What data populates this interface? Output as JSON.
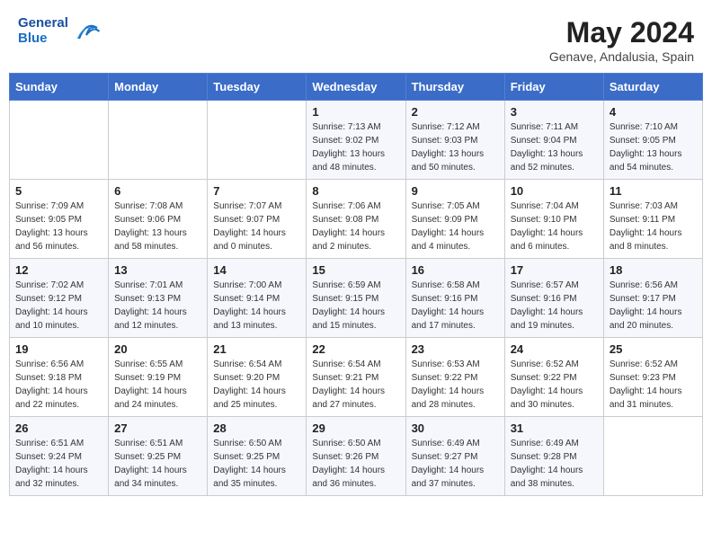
{
  "header": {
    "logo_general": "General",
    "logo_blue": "Blue",
    "month_year": "May 2024",
    "location": "Genave, Andalusia, Spain"
  },
  "weekdays": [
    "Sunday",
    "Monday",
    "Tuesday",
    "Wednesday",
    "Thursday",
    "Friday",
    "Saturday"
  ],
  "weeks": [
    [
      {
        "day": "",
        "sunrise": "",
        "sunset": "",
        "daylight": ""
      },
      {
        "day": "",
        "sunrise": "",
        "sunset": "",
        "daylight": ""
      },
      {
        "day": "",
        "sunrise": "",
        "sunset": "",
        "daylight": ""
      },
      {
        "day": "1",
        "sunrise": "Sunrise: 7:13 AM",
        "sunset": "Sunset: 9:02 PM",
        "daylight": "Daylight: 13 hours and 48 minutes."
      },
      {
        "day": "2",
        "sunrise": "Sunrise: 7:12 AM",
        "sunset": "Sunset: 9:03 PM",
        "daylight": "Daylight: 13 hours and 50 minutes."
      },
      {
        "day": "3",
        "sunrise": "Sunrise: 7:11 AM",
        "sunset": "Sunset: 9:04 PM",
        "daylight": "Daylight: 13 hours and 52 minutes."
      },
      {
        "day": "4",
        "sunrise": "Sunrise: 7:10 AM",
        "sunset": "Sunset: 9:05 PM",
        "daylight": "Daylight: 13 hours and 54 minutes."
      }
    ],
    [
      {
        "day": "5",
        "sunrise": "Sunrise: 7:09 AM",
        "sunset": "Sunset: 9:05 PM",
        "daylight": "Daylight: 13 hours and 56 minutes."
      },
      {
        "day": "6",
        "sunrise": "Sunrise: 7:08 AM",
        "sunset": "Sunset: 9:06 PM",
        "daylight": "Daylight: 13 hours and 58 minutes."
      },
      {
        "day": "7",
        "sunrise": "Sunrise: 7:07 AM",
        "sunset": "Sunset: 9:07 PM",
        "daylight": "Daylight: 14 hours and 0 minutes."
      },
      {
        "day": "8",
        "sunrise": "Sunrise: 7:06 AM",
        "sunset": "Sunset: 9:08 PM",
        "daylight": "Daylight: 14 hours and 2 minutes."
      },
      {
        "day": "9",
        "sunrise": "Sunrise: 7:05 AM",
        "sunset": "Sunset: 9:09 PM",
        "daylight": "Daylight: 14 hours and 4 minutes."
      },
      {
        "day": "10",
        "sunrise": "Sunrise: 7:04 AM",
        "sunset": "Sunset: 9:10 PM",
        "daylight": "Daylight: 14 hours and 6 minutes."
      },
      {
        "day": "11",
        "sunrise": "Sunrise: 7:03 AM",
        "sunset": "Sunset: 9:11 PM",
        "daylight": "Daylight: 14 hours and 8 minutes."
      }
    ],
    [
      {
        "day": "12",
        "sunrise": "Sunrise: 7:02 AM",
        "sunset": "Sunset: 9:12 PM",
        "daylight": "Daylight: 14 hours and 10 minutes."
      },
      {
        "day": "13",
        "sunrise": "Sunrise: 7:01 AM",
        "sunset": "Sunset: 9:13 PM",
        "daylight": "Daylight: 14 hours and 12 minutes."
      },
      {
        "day": "14",
        "sunrise": "Sunrise: 7:00 AM",
        "sunset": "Sunset: 9:14 PM",
        "daylight": "Daylight: 14 hours and 13 minutes."
      },
      {
        "day": "15",
        "sunrise": "Sunrise: 6:59 AM",
        "sunset": "Sunset: 9:15 PM",
        "daylight": "Daylight: 14 hours and 15 minutes."
      },
      {
        "day": "16",
        "sunrise": "Sunrise: 6:58 AM",
        "sunset": "Sunset: 9:16 PM",
        "daylight": "Daylight: 14 hours and 17 minutes."
      },
      {
        "day": "17",
        "sunrise": "Sunrise: 6:57 AM",
        "sunset": "Sunset: 9:16 PM",
        "daylight": "Daylight: 14 hours and 19 minutes."
      },
      {
        "day": "18",
        "sunrise": "Sunrise: 6:56 AM",
        "sunset": "Sunset: 9:17 PM",
        "daylight": "Daylight: 14 hours and 20 minutes."
      }
    ],
    [
      {
        "day": "19",
        "sunrise": "Sunrise: 6:56 AM",
        "sunset": "Sunset: 9:18 PM",
        "daylight": "Daylight: 14 hours and 22 minutes."
      },
      {
        "day": "20",
        "sunrise": "Sunrise: 6:55 AM",
        "sunset": "Sunset: 9:19 PM",
        "daylight": "Daylight: 14 hours and 24 minutes."
      },
      {
        "day": "21",
        "sunrise": "Sunrise: 6:54 AM",
        "sunset": "Sunset: 9:20 PM",
        "daylight": "Daylight: 14 hours and 25 minutes."
      },
      {
        "day": "22",
        "sunrise": "Sunrise: 6:54 AM",
        "sunset": "Sunset: 9:21 PM",
        "daylight": "Daylight: 14 hours and 27 minutes."
      },
      {
        "day": "23",
        "sunrise": "Sunrise: 6:53 AM",
        "sunset": "Sunset: 9:22 PM",
        "daylight": "Daylight: 14 hours and 28 minutes."
      },
      {
        "day": "24",
        "sunrise": "Sunrise: 6:52 AM",
        "sunset": "Sunset: 9:22 PM",
        "daylight": "Daylight: 14 hours and 30 minutes."
      },
      {
        "day": "25",
        "sunrise": "Sunrise: 6:52 AM",
        "sunset": "Sunset: 9:23 PM",
        "daylight": "Daylight: 14 hours and 31 minutes."
      }
    ],
    [
      {
        "day": "26",
        "sunrise": "Sunrise: 6:51 AM",
        "sunset": "Sunset: 9:24 PM",
        "daylight": "Daylight: 14 hours and 32 minutes."
      },
      {
        "day": "27",
        "sunrise": "Sunrise: 6:51 AM",
        "sunset": "Sunset: 9:25 PM",
        "daylight": "Daylight: 14 hours and 34 minutes."
      },
      {
        "day": "28",
        "sunrise": "Sunrise: 6:50 AM",
        "sunset": "Sunset: 9:25 PM",
        "daylight": "Daylight: 14 hours and 35 minutes."
      },
      {
        "day": "29",
        "sunrise": "Sunrise: 6:50 AM",
        "sunset": "Sunset: 9:26 PM",
        "daylight": "Daylight: 14 hours and 36 minutes."
      },
      {
        "day": "30",
        "sunrise": "Sunrise: 6:49 AM",
        "sunset": "Sunset: 9:27 PM",
        "daylight": "Daylight: 14 hours and 37 minutes."
      },
      {
        "day": "31",
        "sunrise": "Sunrise: 6:49 AM",
        "sunset": "Sunset: 9:28 PM",
        "daylight": "Daylight: 14 hours and 38 minutes."
      },
      {
        "day": "",
        "sunrise": "",
        "sunset": "",
        "daylight": ""
      }
    ]
  ]
}
